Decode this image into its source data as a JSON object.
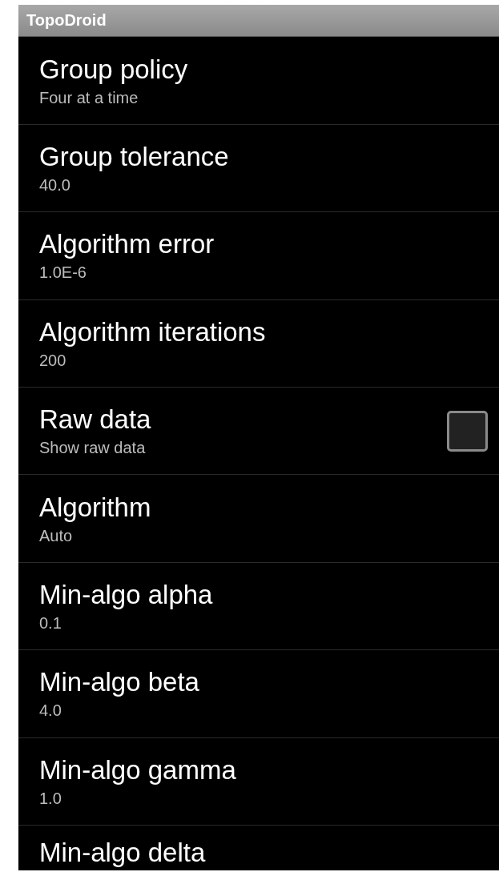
{
  "app_bar": {
    "title": "TopoDroid"
  },
  "preferences": [
    {
      "kind": "value",
      "title": "Group policy",
      "summary": "Four at a time"
    },
    {
      "kind": "value",
      "title": "Group tolerance",
      "summary": "40.0"
    },
    {
      "kind": "value",
      "title": "Algorithm error",
      "summary": "1.0E-6"
    },
    {
      "kind": "value",
      "title": "Algorithm iterations",
      "summary": "200"
    },
    {
      "kind": "checkbox",
      "title": "Raw data",
      "summary": "Show raw data",
      "checked": false
    },
    {
      "kind": "value",
      "title": "Algorithm",
      "summary": "Auto"
    },
    {
      "kind": "value",
      "title": "Min-algo alpha",
      "summary": "0.1"
    },
    {
      "kind": "value",
      "title": "Min-algo beta",
      "summary": "4.0"
    },
    {
      "kind": "value",
      "title": "Min-algo gamma",
      "summary": "1.0"
    },
    {
      "kind": "value",
      "title": "Min-algo delta"
    }
  ]
}
